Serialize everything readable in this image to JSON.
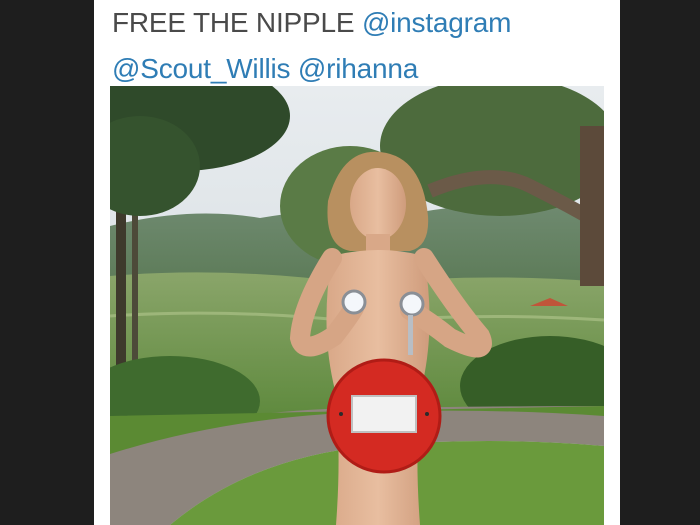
{
  "tweet": {
    "text_prefix": "FREE THE NIPPLE",
    "mention_1": "@instagram",
    "mention_2": "@Scout_Willis",
    "mention_3": "@rihanna",
    "colors": {
      "text": "#4a4a4a",
      "mention": "#2f7db5",
      "background": "#ffffff",
      "frame": "#1e1e1e"
    }
  },
  "photo": {
    "description_icon": "embedded-photo",
    "sign_color": "#d42a22"
  }
}
